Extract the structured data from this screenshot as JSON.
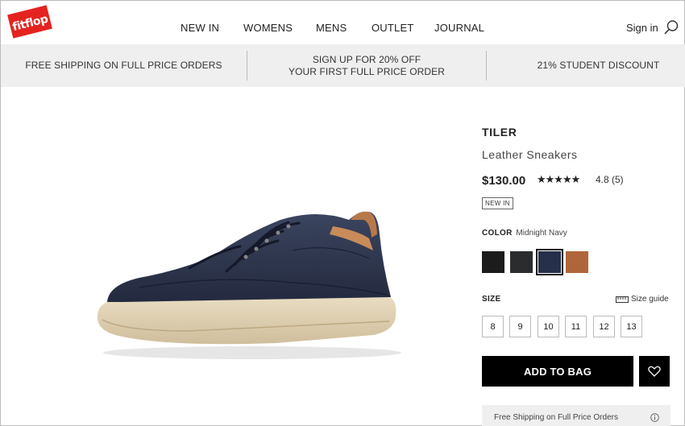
{
  "brand": {
    "logo_text": "fitflop",
    "color": "#e4231f"
  },
  "nav": {
    "items": [
      "NEW IN",
      "WOMENS",
      "MENS",
      "OUTLET",
      "JOURNAL"
    ],
    "signin": "Sign in",
    "search_icon": "search-icon"
  },
  "promo": {
    "left": "FREE SHIPPING ON FULL PRICE ORDERS",
    "center_line1": "SIGN UP FOR 20% OFF",
    "center_line2": "YOUR FIRST FULL PRICE ORDER",
    "right": "21% STUDENT DISCOUNT"
  },
  "product": {
    "name": "TILER",
    "subtitle": "Leather Sneakers",
    "price": "$130.00",
    "stars": "★★★★★",
    "rating_text": "4.8 (5)",
    "badge": "NEW IN",
    "color_label": "COLOR",
    "color_value": "Midnight Navy",
    "swatches": [
      {
        "name": "black",
        "color": "#1c1c1c"
      },
      {
        "name": "dark-charcoal",
        "color": "#2a2c2e"
      },
      {
        "name": "midnight-navy",
        "color": "#27304a"
      },
      {
        "name": "tan",
        "color": "#b1653a"
      }
    ],
    "selected_swatch": 2,
    "size_label": "SIZE",
    "size_guide": "Size guide",
    "sizes": [
      "8",
      "9",
      "10",
      "11",
      "12",
      "13"
    ],
    "add_to_bag": "ADD TO BAG",
    "shipping_note": "Free Shipping on Full Price Orders"
  }
}
